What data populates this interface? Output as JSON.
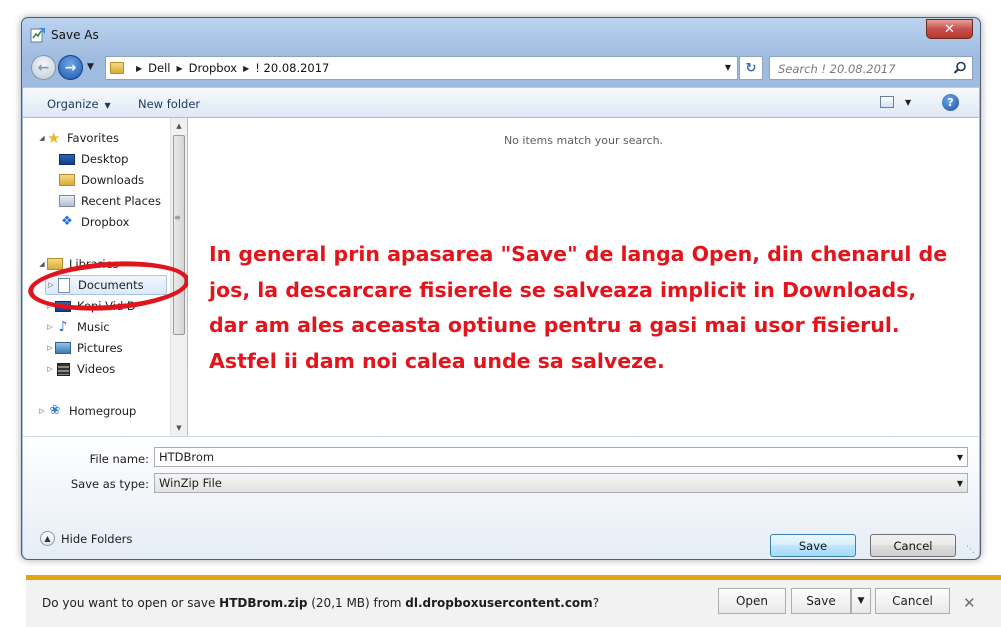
{
  "window": {
    "title": "Save As",
    "close_label": "✕"
  },
  "address": {
    "crumbs": [
      "Dell",
      "Dropbox",
      "! 20.08.2017"
    ],
    "search_placeholder": "Search ! 20.08.2017"
  },
  "toolbar": {
    "organize_label": "Organize",
    "new_folder_label": "New folder",
    "help_label": "?"
  },
  "sidebar": {
    "favorites_label": "Favorites",
    "favorites": [
      "Desktop",
      "Downloads",
      "Recent Places",
      "Dropbox"
    ],
    "libraries_label": "Libraries",
    "libraries": [
      "Documents",
      "Kopi Vid D",
      "Music",
      "Pictures",
      "Videos"
    ],
    "homegroup_label": "Homegroup"
  },
  "content": {
    "empty_message": "No items match your search.",
    "annotation": "In general prin apasarea \"Save\" de langa Open, din chenarul de jos, la descarcare fisierele se salveaza implicit in Downloads, dar am ales aceasta optiune pentru a gasi mai usor fisierul. Astfel ii dam noi calea unde sa salveze."
  },
  "form": {
    "file_name_label": "File name:",
    "file_name_value": "HTDBrom",
    "save_type_label": "Save as type:",
    "save_type_value": "WinZip File",
    "hide_folders_label": "Hide Folders",
    "save_button": "Save",
    "cancel_button": "Cancel"
  },
  "notification": {
    "prefix": "Do you want to open or save ",
    "file": "HTDBrom.zip",
    "size": " (20,1 MB) from ",
    "source": "dl.dropboxusercontent.com",
    "suffix": "?",
    "open_button": "Open",
    "save_button": "Save",
    "cancel_button": "Cancel"
  },
  "colors": {
    "annotation": "#e3141b",
    "notification_accent": "#e2a516"
  }
}
